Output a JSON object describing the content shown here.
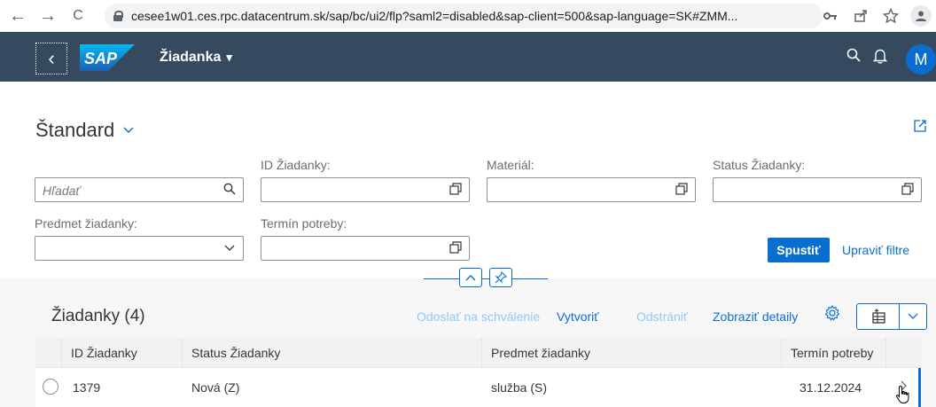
{
  "browser": {
    "url": "cesee1w01.ces.rpc.datacentrum.sk/sap/bc/ui2/flp?saml2=disabled&sap-client=500&sap-language=SK#ZMM...",
    "back_icon": "←",
    "forward_icon": "→",
    "reload_icon": "C"
  },
  "shell": {
    "app_title": "Žiadanka",
    "title_caret": "▾",
    "back_icon": "‹",
    "search_icon": "⌕",
    "bell_icon": "🔔",
    "avatar_initial": "M",
    "logo_text": "SAP"
  },
  "filter": {
    "variant_name": "Štandard",
    "variant_chevron": "⌵",
    "search_placeholder": "Hľadať",
    "labels": {
      "request_id": "ID Žiadanky",
      "material": "Materiál:",
      "status": "Status Žiadanky:",
      "subject": "Predmet žiadanky:",
      "due_date": "Termín potreby:"
    },
    "request_id_label": "ID Žiadanky:",
    "go_button": "Spustiť",
    "adapt_filters": "Upraviť filtre"
  },
  "table": {
    "title": "Žiadanky (4)",
    "actions": {
      "submit": "Odoslať na schválenie",
      "create": "Vytvoriť",
      "delete": "Odstrániť",
      "details": "Zobraziť detaily"
    },
    "columns": [
      "ID Žiadanky",
      "Status Žiadanky",
      "Predmet žiadanky",
      "Termín potreby"
    ],
    "rows": [
      {
        "id": "1379",
        "status": "Nová (Z)",
        "subject": "služba (S)",
        "due": "31.12.2024"
      }
    ]
  },
  "colors": {
    "shell_bg": "#354a5f",
    "accent": "#0a6ed1",
    "disabled_action": "#91c8f6"
  }
}
